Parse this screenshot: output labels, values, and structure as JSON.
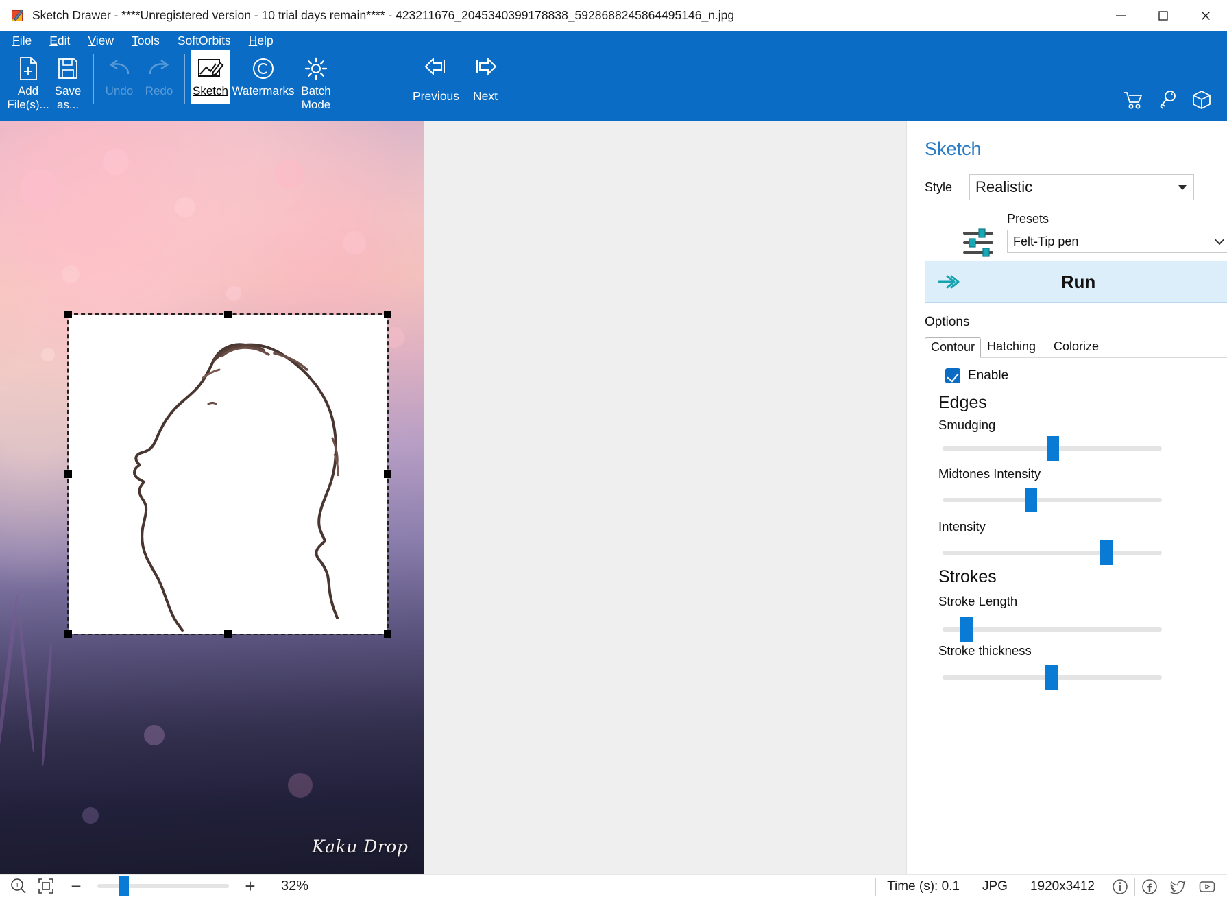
{
  "window": {
    "title": "Sketch Drawer - ****Unregistered version - 10 trial days remain**** - 423211676_2045340399178838_5928688245864495146_n.jpg",
    "app_icon": "sketch-drawer-logo",
    "minimize_label": "Minimize",
    "maximize_label": "Maximize",
    "close_label": "Close"
  },
  "menu": {
    "items": [
      {
        "label": "File",
        "accel": "F"
      },
      {
        "label": "Edit",
        "accel": "E"
      },
      {
        "label": "View",
        "accel": "V"
      },
      {
        "label": "Tools",
        "accel": "T"
      },
      {
        "label": "SoftOrbits",
        "accel": ""
      },
      {
        "label": "Help",
        "accel": "H"
      }
    ]
  },
  "toolbar": {
    "add_files": "Add\nFile(s)...",
    "add_files_line1": "Add",
    "add_files_line2": "File(s)...",
    "save_as_line1": "Save",
    "save_as_line2": "as...",
    "undo": "Undo",
    "redo": "Redo",
    "sketch": "Sketch",
    "watermarks": "Watermarks",
    "batch_line1": "Batch",
    "batch_line2": "Mode",
    "previous": "Previous",
    "next": "Next",
    "right_icons": [
      "cart-icon",
      "key-icon",
      "box-icon"
    ]
  },
  "canvas": {
    "watermark_text": "Kaku Drop",
    "selection_handles": 8
  },
  "panel": {
    "title": "Sketch",
    "style_label": "Style",
    "style_value": "Realistic",
    "presets_label": "Presets",
    "presets_value": "Felt-Tip pen",
    "run_label": "Run",
    "options_label": "Options",
    "tabs": [
      {
        "label": "Contour",
        "active": true
      },
      {
        "label": "Hatching",
        "active": false
      },
      {
        "label": "Colorize",
        "active": false
      }
    ],
    "enable_label": "Enable",
    "enable_checked": true,
    "sections": [
      {
        "heading": "Edges",
        "sliders": [
          {
            "label": "Smudging",
            "percent": 50
          },
          {
            "label": "Midtones Intensity",
            "percent": 40
          },
          {
            "label": "Intensity",
            "percent": 72
          }
        ]
      },
      {
        "heading": "Strokes",
        "sliders": [
          {
            "label": "Stroke Length",
            "percent": 11
          },
          {
            "label": "Stroke thickness",
            "percent": 55
          }
        ]
      }
    ],
    "accent_color": "#0a7bd4",
    "title_color": "#2b7cc4",
    "run_bg_color": "#ddeefb"
  },
  "statusbar": {
    "zoom_reset_icon": "zoom-actual-size-icon",
    "fit_icon": "fit-to-window-icon",
    "zoom_out_label": "−",
    "zoom_in_label": "+",
    "zoom_value": "32%",
    "zoom_percent": 32,
    "time_label": "Time (s): 0.1",
    "format_label": "JPG",
    "dimensions_label": "1920x3412",
    "social_icons": [
      "info-icon",
      "facebook-icon",
      "twitter-icon",
      "youtube-icon"
    ]
  }
}
